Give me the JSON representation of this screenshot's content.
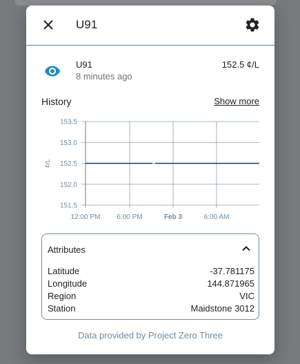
{
  "dialog": {
    "title": "U91",
    "icons": {
      "close": "close-icon",
      "settings": "gear-icon",
      "state": "eye-icon",
      "collapse": "chevron-up-icon"
    }
  },
  "entity": {
    "name": "U91",
    "last_changed": "8 minutes ago",
    "value": "152.5 ¢/L"
  },
  "history": {
    "title": "History",
    "show_more": "Show more"
  },
  "chart_data": {
    "type": "line",
    "ylabel": "¢/L",
    "y_ticks": [
      "153.5",
      "153.0",
      "152.5",
      "152.0",
      "151.5"
    ],
    "ylim": [
      151.5,
      153.5
    ],
    "x_ticks": [
      "12:00 PM",
      "6:00 PM",
      "Feb 3",
      "6:00 AM"
    ],
    "grid": true,
    "series": [
      {
        "segments": [
          {
            "x": [
              "12:00 PM",
              "2 Feb 11:30 PM"
            ],
            "y": [
              152.5,
              152.5
            ]
          },
          {
            "x": [
              "3 Feb 12:10 AM",
              "3 Feb 1:00 PM"
            ],
            "y": [
              152.5,
              152.5
            ]
          }
        ]
      }
    ],
    "color": "#0d3d66"
  },
  "attributes": {
    "title": "Attributes",
    "rows": [
      {
        "key": "Latitude",
        "value": "-37.781175"
      },
      {
        "key": "Longitude",
        "value": "144.871965"
      },
      {
        "key": "Region",
        "value": "VIC"
      },
      {
        "key": "Station",
        "value": "Maidstone 3012"
      }
    ]
  },
  "footer": "Data provided by Project Zero Three",
  "colors": {
    "accent": "#1e8bc3",
    "line": "#0d3d66",
    "grid": "#5f7d94",
    "tick": "#6f8ca3"
  }
}
